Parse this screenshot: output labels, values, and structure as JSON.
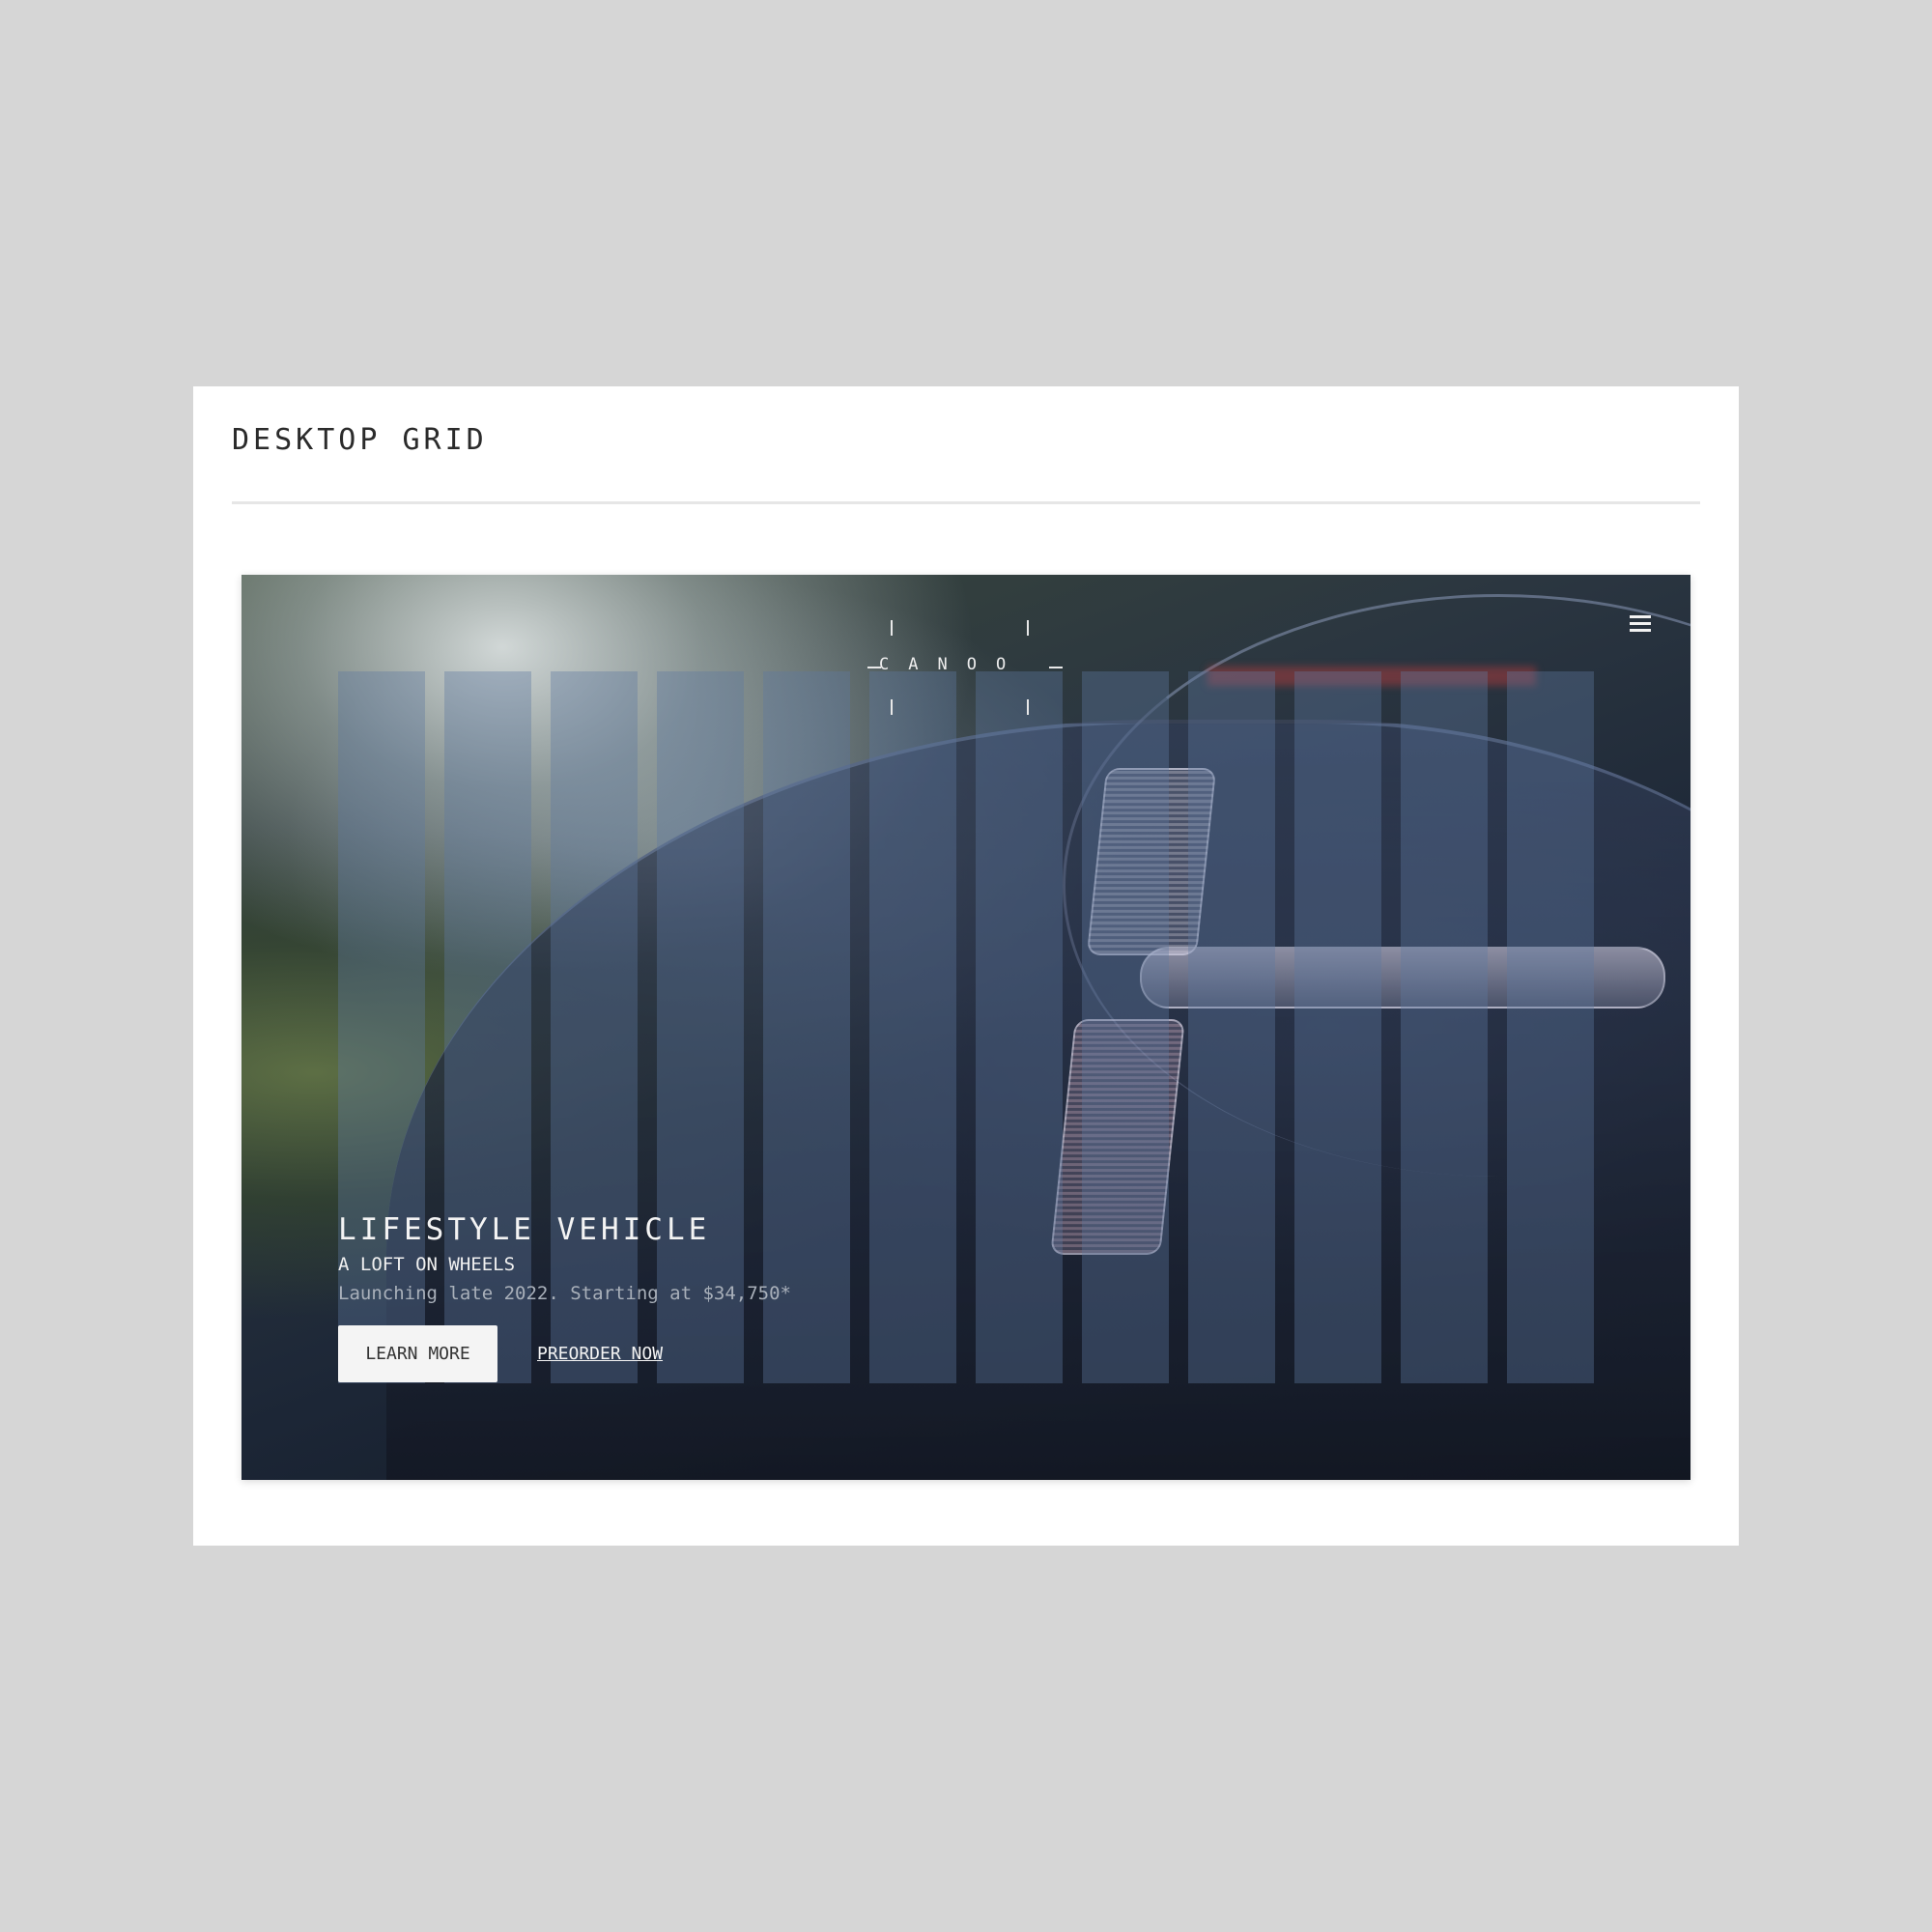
{
  "section": {
    "title": "DESKTOP GRID"
  },
  "hero": {
    "logo_text": "CANOO",
    "title": "LIFESTYLE VEHICLE",
    "subtitle": "A LOFT ON WHEELS",
    "description": "Launching late 2022. Starting at $34,750*",
    "primary_button": "LEARN MORE",
    "secondary_link": "PREORDER NOW",
    "menu_icon": "hamburger-menu-icon"
  },
  "grid": {
    "columns": 12,
    "overlay_color": "#5f78a0"
  },
  "colors": {
    "page_background": "#d6d6d6",
    "card_background": "#ffffff",
    "title_text": "#2b2b2b",
    "hero_text": "#f4f4f4",
    "hero_muted_text": "#a9b0ba",
    "button_background": "#f4f4f4"
  }
}
